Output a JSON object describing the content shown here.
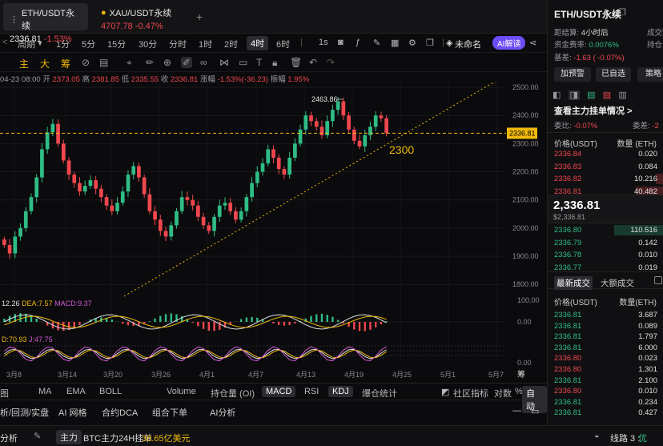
{
  "tabs": [
    {
      "symbol": "ETH/USDT永续",
      "price": "2336.81",
      "change": "-1.53%"
    },
    {
      "symbol": "XAU/USDT永续",
      "price": "4707.78",
      "change": "-0.47%"
    }
  ],
  "add_tab": "+",
  "toolbar": {
    "items": [
      "周期",
      "1分",
      "5分",
      "15分",
      "30分",
      "分时",
      "1时",
      "2时",
      "4时",
      "6时",
      "1s"
    ],
    "selected": "4时",
    "template": "未命名",
    "ai": "AI解读"
  },
  "draw_toolbar": {
    "items": [
      "主",
      "大",
      "筹"
    ]
  },
  "ohlc": {
    "date": "04-23 08:00",
    "open_label": "开",
    "open": "2373.05",
    "high_label": "高",
    "high": "2381.85",
    "low_label": "低",
    "low": "2335.55",
    "close_label": "收",
    "close": "2336.81",
    "chg_label": "涨幅",
    "chg": "-1.53%(-36.23)",
    "amp_label": "振幅",
    "amp": "1.95%"
  },
  "chart_data": {
    "type": "candlestick",
    "y_ticks": [
      "2500.00",
      "2400.00",
      "2300.00",
      "2200.00",
      "2100.00",
      "2000.00",
      "1900.00",
      "1800.00"
    ],
    "x_ticks": [
      "3月8",
      "3月14",
      "3月20",
      "3月26",
      "4月1",
      "4月7",
      "4月13",
      "4月19",
      "4月25",
      "5月1",
      "5月7"
    ],
    "last_price": "2336.81",
    "high_label": "2463.86",
    "annotation": "2300",
    "closes": [
      1940,
      1910,
      1970,
      2000,
      2060,
      2110,
      2180,
      2280,
      2340,
      2370,
      2300,
      2240,
      2190,
      2160,
      2130,
      2150,
      2170,
      2140,
      2110,
      2080,
      2060,
      2090,
      2130,
      2190,
      2220,
      2180,
      2120,
      2060,
      2030,
      1990,
      1970,
      2010,
      2060,
      2110,
      2100,
      2080,
      2040,
      2010,
      1990,
      2040,
      2080,
      2090,
      2060,
      2030,
      2060,
      2110,
      2160,
      2200,
      2230,
      2280,
      2250,
      2210,
      2190,
      2250,
      2300,
      2350,
      2400,
      2380,
      2360,
      2330,
      2380,
      2420,
      2450,
      2400,
      2350,
      2310,
      2290,
      2330,
      2360,
      2400,
      2390,
      2337
    ]
  },
  "indicators": {
    "macd": {
      "dif": "12.26",
      "dea": "DEA:7.57",
      "macd": "MACD:9.37",
      "ticks": [
        "100.00",
        "0.00"
      ]
    },
    "kdj": {
      "d": "D:70.93",
      "j": "J:47.75",
      "ticks": [
        "0.00"
      ]
    }
  },
  "indicator_tabs": [
    "图",
    "MA",
    "EMA",
    "BOLL",
    "Volume",
    "持仓量 (OI)",
    "MACD",
    "RSI",
    "KDJ",
    "爆仓统计",
    "社区指标",
    "对数",
    "%",
    "自动"
  ],
  "indicator_active": [
    "MACD",
    "KDJ",
    "自动"
  ],
  "bottom_tools": [
    "析/回测/实盘",
    "AI 网格",
    "合约DCA",
    "组合下单",
    "AI分析"
  ],
  "status": {
    "left": "分析",
    "badge": "主力",
    "ticker_prefix": "BTC主力24H挂单",
    "ticker_value": "38.65亿美元",
    "line_label": "线路 3 :",
    "line_quality": "优"
  },
  "panel": {
    "title": "ETH/USDT永续",
    "settle_label": "距结算:",
    "settle_value": "4小时后",
    "fund_label": "资金费率:",
    "fund_value": "0.0076%",
    "basis_label": "基差:",
    "basis_value": "-1.63 ( -0.07%)",
    "vol_label": "成交额",
    "oi_label": "持仓量",
    "btn_alert": "加预警",
    "btn_fav": "已自选",
    "btn_strategy": "策略",
    "orders_title": "查看主力挂单情况 >",
    "weibi_label": "委比:",
    "weibi_value": "-0.07%",
    "weicha_label": "委差:",
    "weicha_value": "-2",
    "ob_header_price": "价格(USDT)",
    "ob_header_qty": "数量 (ETH)",
    "asks": [
      {
        "p": "2336.84",
        "q": "0.020"
      },
      {
        "p": "2336.83",
        "q": "0.084"
      },
      {
        "p": "2336.82",
        "q": "10.216"
      },
      {
        "p": "2336.81",
        "q": "40.482"
      }
    ],
    "mid_price": "2,336.81",
    "mid_sub": "$2,336.81",
    "bids": [
      {
        "p": "2336.80",
        "q": "110.516"
      },
      {
        "p": "2336.79",
        "q": "0.142"
      },
      {
        "p": "2336.78",
        "q": "0.010"
      },
      {
        "p": "2336.77",
        "q": "0.019"
      }
    ],
    "trades_tab1": "最新成交",
    "trades_tab2": "大额成交",
    "tr_header_price": "价格(USDT)",
    "tr_header_qty": "数量(ETH)",
    "trades": [
      {
        "p": "2336.81",
        "q": "3.687",
        "side": "buy"
      },
      {
        "p": "2336.81",
        "q": "0.089",
        "side": "buy"
      },
      {
        "p": "2336.81",
        "q": "1.797",
        "side": "buy"
      },
      {
        "p": "2336.81",
        "q": "6.000",
        "side": "buy"
      },
      {
        "p": "2336.80",
        "q": "0.023",
        "side": "sell"
      },
      {
        "p": "2336.80",
        "q": "1.301",
        "side": "sell"
      },
      {
        "p": "2336.81",
        "q": "2.100",
        "side": "buy"
      },
      {
        "p": "2336.80",
        "q": "0.010",
        "side": "sell"
      },
      {
        "p": "2336.81",
        "q": "0.234",
        "side": "buy"
      },
      {
        "p": "2336.81",
        "q": "0.427",
        "side": "buy"
      }
    ]
  }
}
